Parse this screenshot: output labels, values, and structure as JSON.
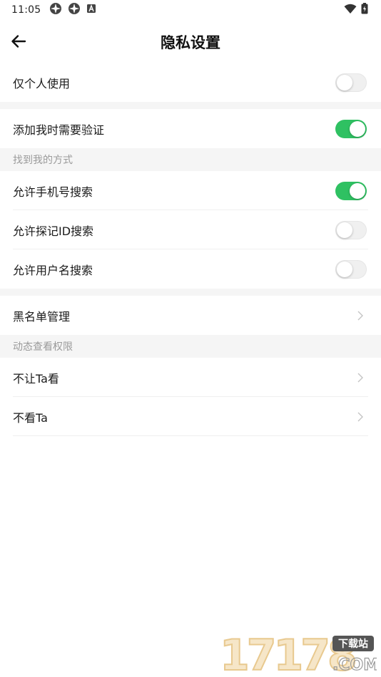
{
  "status_bar": {
    "time": "11:05"
  },
  "nav": {
    "title": "隐私设置"
  },
  "items": {
    "self_only": {
      "label": "仅个人使用",
      "enabled": false
    },
    "verify_add": {
      "label": "添加我时需要验证",
      "enabled": true
    },
    "find_me_header": "找到我的方式",
    "search_phone": {
      "label": "允许手机号搜索",
      "enabled": true
    },
    "search_id": {
      "label": "允许探记ID搜索",
      "enabled": false
    },
    "search_username": {
      "label": "允许用户名搜索",
      "enabled": false
    },
    "blacklist": {
      "label": "黑名单管理"
    },
    "moments_header": "动态查看权限",
    "hide_from": {
      "label": "不让Ta看"
    },
    "dont_see": {
      "label": "不看Ta"
    }
  },
  "watermark": {
    "text": "17178",
    "badge": "下载站",
    "domain": ".COM"
  },
  "colors": {
    "toggle_on": "#2fc162",
    "toggle_off": "#f0f0f0",
    "section_bg": "#f5f5f5",
    "section_text": "#9a9a9a"
  }
}
